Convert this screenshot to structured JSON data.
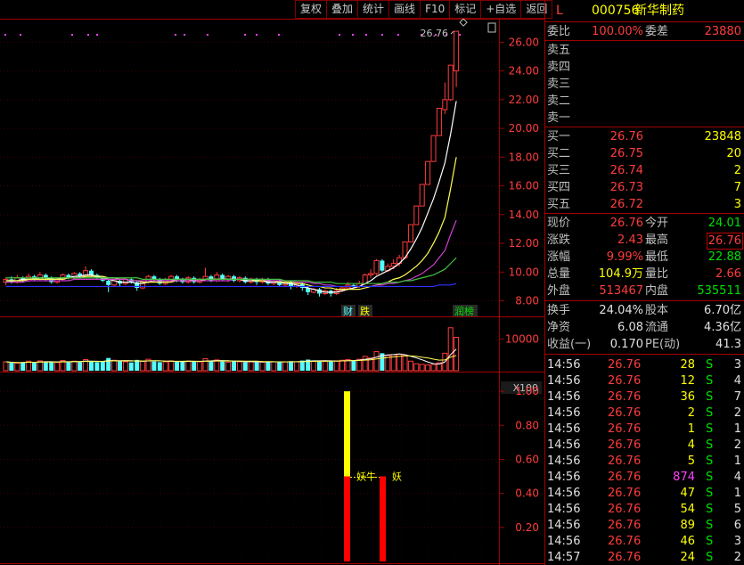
{
  "toolbar": [
    "复权",
    "叠加",
    "统计",
    "画线",
    "F10",
    "标记",
    "+自选",
    "返回"
  ],
  "stock": {
    "flag": "L",
    "code": "000756",
    "name": "新华制药"
  },
  "weibi": {
    "label1": "委比",
    "value1": "100.00%",
    "label2": "委差",
    "value2": "23880"
  },
  "sells": [
    {
      "label": "卖五",
      "price": "",
      "vol": ""
    },
    {
      "label": "卖四",
      "price": "",
      "vol": ""
    },
    {
      "label": "卖三",
      "price": "",
      "vol": ""
    },
    {
      "label": "卖二",
      "price": "",
      "vol": ""
    },
    {
      "label": "卖一",
      "price": "",
      "vol": ""
    }
  ],
  "buys": [
    {
      "label": "买一",
      "price": "26.76",
      "vol": "23848"
    },
    {
      "label": "买二",
      "price": "26.75",
      "vol": "20"
    },
    {
      "label": "买三",
      "price": "26.74",
      "vol": "2"
    },
    {
      "label": "买四",
      "price": "26.73",
      "vol": "7"
    },
    {
      "label": "买五",
      "price": "26.72",
      "vol": "3"
    }
  ],
  "quote": [
    {
      "l1": "现价",
      "v1": "26.76",
      "l2": "今开",
      "v2": "24.01"
    },
    {
      "l1": "涨跌",
      "v1": "2.43",
      "l2": "最高",
      "v2": "26.76"
    },
    {
      "l1": "涨幅",
      "v1": "9.99%",
      "l2": "最低",
      "v2": "22.88"
    },
    {
      "l1": "总量",
      "v1": "104.9万",
      "l2": "量比",
      "v2": "2.66"
    },
    {
      "l1": "外盘",
      "v1": "513467",
      "l2": "内盘",
      "v2": "535511"
    }
  ],
  "fund": [
    {
      "l1": "换手",
      "v1": "24.04%",
      "l2": "股本",
      "v2": "6.70亿"
    },
    {
      "l1": "净资",
      "v1": "6.08",
      "l2": "流通",
      "v2": "4.36亿"
    },
    {
      "l1": "收益(一)",
      "v1": "0.170",
      "l2": "PE(动)",
      "v2": "41.3"
    }
  ],
  "ticks": [
    {
      "time": "14:56",
      "price": "26.76",
      "vol": "28",
      "side": "S",
      "n": "3"
    },
    {
      "time": "14:56",
      "price": "26.76",
      "vol": "12",
      "side": "S",
      "n": "4"
    },
    {
      "time": "14:56",
      "price": "26.76",
      "vol": "36",
      "side": "S",
      "n": "7"
    },
    {
      "time": "14:56",
      "price": "26.76",
      "vol": "2",
      "side": "S",
      "n": "2"
    },
    {
      "time": "14:56",
      "price": "26.76",
      "vol": "1",
      "side": "S",
      "n": "1"
    },
    {
      "time": "14:56",
      "price": "26.76",
      "vol": "4",
      "side": "S",
      "n": "2"
    },
    {
      "time": "14:56",
      "price": "26.76",
      "vol": "5",
      "side": "S",
      "n": "1"
    },
    {
      "time": "14:56",
      "price": "26.76",
      "vol": "874",
      "side": "S",
      "n": "4"
    },
    {
      "time": "14:56",
      "price": "26.76",
      "vol": "47",
      "side": "S",
      "n": "1"
    },
    {
      "time": "14:56",
      "price": "26.76",
      "vol": "54",
      "side": "S",
      "n": "5"
    },
    {
      "time": "14:56",
      "price": "26.76",
      "vol": "89",
      "side": "S",
      "n": "6"
    },
    {
      "time": "14:56",
      "price": "26.76",
      "vol": "46",
      "side": "S",
      "n": "3"
    },
    {
      "time": "14:57",
      "price": "26.76",
      "vol": "24",
      "side": "S",
      "n": "2"
    }
  ],
  "chart_data": {
    "type": "candlestick",
    "price_ticks": [
      "26.00",
      "24.00",
      "22.00",
      "20.00",
      "18.00",
      "16.00",
      "14.00",
      "12.00",
      "10.00",
      "8.00"
    ],
    "price_ylim": [
      7.6,
      27.2
    ],
    "high_annotation": "26.76",
    "volume_tick": "10000",
    "volume_unit": "X100",
    "indicator_ticks": [
      "1.00",
      "0.80",
      "0.60",
      "0.40",
      "0.20"
    ],
    "indicator_ylim": [
      0,
      1.1
    ],
    "event_labels": [
      "财",
      "跌",
      "润榜"
    ],
    "indicator_labels": [
      "妖牛",
      "妖"
    ],
    "candles": [
      [
        9.3,
        9.5,
        9.1,
        9.6
      ],
      [
        9.5,
        9.3,
        9.2,
        9.7
      ],
      [
        9.3,
        9.6,
        9.2,
        9.8
      ],
      [
        9.6,
        9.4,
        9.3,
        9.7
      ],
      [
        9.4,
        9.7,
        9.3,
        9.9
      ],
      [
        9.7,
        9.5,
        9.4,
        9.8
      ],
      [
        9.5,
        9.8,
        9.4,
        10.0
      ],
      [
        9.8,
        9.6,
        9.4,
        9.9
      ],
      [
        9.6,
        9.3,
        9.2,
        9.7
      ],
      [
        9.3,
        9.5,
        9.2,
        9.6
      ],
      [
        9.5,
        9.8,
        9.4,
        9.9
      ],
      [
        9.8,
        9.6,
        9.5,
        9.9
      ],
      [
        9.6,
        9.9,
        9.5,
        10.0
      ],
      [
        9.9,
        9.7,
        9.6,
        10.0
      ],
      [
        9.7,
        10.1,
        9.6,
        10.4
      ],
      [
        10.1,
        9.8,
        9.7,
        10.2
      ],
      [
        9.8,
        9.6,
        9.5,
        9.9
      ],
      [
        9.6,
        9.4,
        9.3,
        9.7
      ],
      [
        9.4,
        9.1,
        8.6,
        9.5
      ],
      [
        9.1,
        9.4,
        9.0,
        9.5
      ],
      [
        9.4,
        9.2,
        9.0,
        9.5
      ],
      [
        9.2,
        9.5,
        9.1,
        9.6
      ],
      [
        9.5,
        9.3,
        9.2,
        9.6
      ],
      [
        9.3,
        8.9,
        8.7,
        9.4
      ],
      [
        8.9,
        9.3,
        8.8,
        9.4
      ],
      [
        9.3,
        9.7,
        9.2,
        9.8
      ],
      [
        9.7,
        9.5,
        9.3,
        9.8
      ],
      [
        9.5,
        9.2,
        9.1,
        9.6
      ],
      [
        9.2,
        9.5,
        9.1,
        9.6
      ],
      [
        9.5,
        9.7,
        9.3,
        9.8
      ],
      [
        9.7,
        9.5,
        9.3,
        9.8
      ],
      [
        9.5,
        9.3,
        9.2,
        9.6
      ],
      [
        9.3,
        9.6,
        9.2,
        9.7
      ],
      [
        9.6,
        9.3,
        9.2,
        9.7
      ],
      [
        9.3,
        9.5,
        9.2,
        9.6
      ],
      [
        9.5,
        9.7,
        9.4,
        10.3
      ],
      [
        9.7,
        9.4,
        9.3,
        9.8
      ],
      [
        9.4,
        9.8,
        9.3,
        10.0
      ],
      [
        9.8,
        9.5,
        9.4,
        9.9
      ],
      [
        9.5,
        9.7,
        9.3,
        9.8
      ],
      [
        9.7,
        9.4,
        9.3,
        9.8
      ],
      [
        9.4,
        9.6,
        9.3,
        9.7
      ],
      [
        9.6,
        9.3,
        9.2,
        9.7
      ],
      [
        9.3,
        9.5,
        9.2,
        9.6
      ],
      [
        9.5,
        9.3,
        9.1,
        9.6
      ],
      [
        9.3,
        9.5,
        9.2,
        9.6
      ],
      [
        9.5,
        9.2,
        9.1,
        9.6
      ],
      [
        9.2,
        9.4,
        9.1,
        9.5
      ],
      [
        9.4,
        9.1,
        9.0,
        9.5
      ],
      [
        9.1,
        9.3,
        9.0,
        9.4
      ],
      [
        9.3,
        9.0,
        8.8,
        9.4
      ],
      [
        9.0,
        9.2,
        8.9,
        9.3
      ],
      [
        9.2,
        8.9,
        8.7,
        9.3
      ],
      [
        8.9,
        8.6,
        8.4,
        9.0
      ],
      [
        8.6,
        8.8,
        8.5,
        8.9
      ],
      [
        8.8,
        8.5,
        8.3,
        8.9
      ],
      [
        8.5,
        8.7,
        8.4,
        8.8
      ],
      [
        8.7,
        8.5,
        8.3,
        8.8
      ],
      [
        8.5,
        8.7,
        8.4,
        8.9
      ],
      [
        8.7,
        8.9,
        8.6,
        9.0
      ],
      [
        8.9,
        9.1,
        8.8,
        9.3
      ],
      [
        9.1,
        9.0,
        8.9,
        9.2
      ],
      [
        9.0,
        9.2,
        8.9,
        9.4
      ],
      [
        9.2,
        9.8,
        9.1,
        9.9
      ],
      [
        9.8,
        9.9,
        9.6,
        10.2
      ],
      [
        9.9,
        10.8,
        9.8,
        10.9
      ],
      [
        10.8,
        10.1,
        10.0,
        10.9
      ],
      [
        10.1,
        10.4,
        10.0,
        10.6
      ],
      [
        10.4,
        10.6,
        10.2,
        10.9
      ],
      [
        10.6,
        11.0,
        10.4,
        11.2
      ],
      [
        11.0,
        12.1,
        10.9,
        12.1
      ],
      [
        12.1,
        13.3,
        12.1,
        13.3
      ],
      [
        13.3,
        14.6,
        13.3,
        14.6
      ],
      [
        14.6,
        16.1,
        14.6,
        16.1
      ],
      [
        16.1,
        17.7,
        16.1,
        17.7
      ],
      [
        17.7,
        19.5,
        17.7,
        19.5
      ],
      [
        19.5,
        21.4,
        19.5,
        21.4
      ],
      [
        21.3,
        22.0,
        21.0,
        23.2
      ],
      [
        22.0,
        24.4,
        21.9,
        24.4
      ],
      [
        24.0,
        26.76,
        22.88,
        26.76
      ]
    ],
    "volumes": [
      28,
      25,
      24,
      27,
      30,
      26,
      31,
      28,
      27,
      26,
      32,
      29,
      30,
      27,
      35,
      30,
      27,
      28,
      40,
      33,
      30,
      28,
      26,
      34,
      30,
      36,
      29,
      27,
      28,
      31,
      30,
      28,
      30,
      29,
      28,
      38,
      30,
      34,
      29,
      27,
      30,
      28,
      27,
      29,
      28,
      27,
      29,
      28,
      27,
      28,
      30,
      28,
      32,
      35,
      30,
      31,
      29,
      30,
      31,
      33,
      35,
      32,
      36,
      45,
      40,
      60,
      55,
      48,
      50,
      52,
      48,
      30,
      22,
      20,
      18,
      20,
      25,
      55,
      135,
      105
    ],
    "ma_series": [
      {
        "color": "#ffffff",
        "values": [
          9.4,
          9.4,
          9.4,
          9.5,
          9.5,
          9.5,
          9.6,
          9.6,
          9.5,
          9.5,
          9.6,
          9.6,
          9.7,
          9.7,
          9.8,
          9.8,
          9.7,
          9.6,
          9.5,
          9.4,
          9.3,
          9.3,
          9.3,
          9.2,
          9.2,
          9.3,
          9.4,
          9.4,
          9.4,
          9.4,
          9.5,
          9.5,
          9.5,
          9.4,
          9.4,
          9.5,
          9.5,
          9.5,
          9.5,
          9.5,
          9.5,
          9.5,
          9.4,
          9.4,
          9.4,
          9.4,
          9.3,
          9.3,
          9.3,
          9.2,
          9.2,
          9.1,
          9.0,
          8.9,
          8.8,
          8.7,
          8.6,
          8.6,
          8.6,
          8.7,
          8.8,
          8.9,
          9.0,
          9.2,
          9.4,
          9.7,
          9.9,
          10.1,
          10.3,
          10.6,
          11.0,
          11.6,
          12.3,
          13.1,
          14.1,
          15.1,
          16.3,
          17.6,
          19.6,
          21.9
        ]
      },
      {
        "color": "#ffff50",
        "values": [
          9.4,
          9.4,
          9.4,
          9.4,
          9.5,
          9.5,
          9.5,
          9.5,
          9.5,
          9.5,
          9.5,
          9.6,
          9.6,
          9.6,
          9.7,
          9.7,
          9.7,
          9.7,
          9.6,
          9.6,
          9.5,
          9.5,
          9.4,
          9.4,
          9.3,
          9.3,
          9.3,
          9.3,
          9.3,
          9.3,
          9.4,
          9.4,
          9.4,
          9.4,
          9.4,
          9.5,
          9.5,
          9.5,
          9.5,
          9.5,
          9.5,
          9.5,
          9.5,
          9.5,
          9.4,
          9.4,
          9.4,
          9.4,
          9.3,
          9.3,
          9.3,
          9.2,
          9.2,
          9.1,
          9.0,
          9.0,
          8.9,
          8.9,
          8.8,
          8.8,
          8.8,
          8.8,
          8.8,
          8.9,
          9.0,
          9.1,
          9.2,
          9.3,
          9.5,
          9.6,
          9.8,
          10.1,
          10.4,
          10.8,
          11.3,
          12.0,
          12.8,
          13.8,
          15.8,
          18.0
        ]
      },
      {
        "color": "#d040d0",
        "values": [
          9.3,
          9.3,
          9.3,
          9.3,
          9.4,
          9.4,
          9.4,
          9.4,
          9.4,
          9.4,
          9.4,
          9.4,
          9.5,
          9.5,
          9.5,
          9.5,
          9.5,
          9.5,
          9.5,
          9.5,
          9.5,
          9.5,
          9.4,
          9.4,
          9.4,
          9.4,
          9.4,
          9.4,
          9.4,
          9.4,
          9.4,
          9.4,
          9.4,
          9.4,
          9.4,
          9.4,
          9.4,
          9.4,
          9.4,
          9.4,
          9.5,
          9.5,
          9.5,
          9.5,
          9.5,
          9.5,
          9.4,
          9.4,
          9.4,
          9.4,
          9.4,
          9.3,
          9.3,
          9.3,
          9.2,
          9.2,
          9.1,
          9.1,
          9.0,
          9.0,
          9.0,
          9.0,
          9.0,
          9.0,
          9.0,
          9.1,
          9.1,
          9.2,
          9.2,
          9.3,
          9.4,
          9.5,
          9.7,
          9.9,
          10.2,
          10.5,
          11.0,
          11.5,
          12.6,
          13.6
        ]
      },
      {
        "color": "#40c040",
        "values": [
          9.6,
          9.6,
          9.6,
          9.6,
          9.6,
          9.6,
          9.6,
          9.6,
          9.6,
          9.6,
          9.6,
          9.6,
          9.6,
          9.6,
          9.6,
          9.6,
          9.6,
          9.6,
          9.6,
          9.6,
          9.6,
          9.6,
          9.6,
          9.6,
          9.5,
          9.5,
          9.5,
          9.5,
          9.5,
          9.5,
          9.5,
          9.5,
          9.5,
          9.5,
          9.5,
          9.5,
          9.5,
          9.5,
          9.5,
          9.5,
          9.5,
          9.5,
          9.5,
          9.5,
          9.5,
          9.5,
          9.5,
          9.5,
          9.5,
          9.4,
          9.4,
          9.4,
          9.4,
          9.4,
          9.3,
          9.3,
          9.3,
          9.3,
          9.2,
          9.2,
          9.2,
          9.2,
          9.2,
          9.2,
          9.2,
          9.2,
          9.2,
          9.3,
          9.3,
          9.3,
          9.4,
          9.4,
          9.5,
          9.6,
          9.7,
          9.8,
          10.0,
          10.2,
          10.6,
          11.0
        ]
      },
      {
        "color": "#3030ff",
        "values": [
          9.0,
          9.0,
          9.0,
          9.0,
          9.0,
          9.0,
          9.0,
          9.0,
          9.0,
          9.0,
          9.0,
          9.0,
          9.0,
          9.0,
          9.0,
          9.0,
          9.0,
          9.0,
          9.0,
          9.0,
          9.0,
          9.0,
          9.0,
          9.0,
          9.0,
          9.0,
          9.0,
          9.0,
          9.0,
          9.0,
          9.0,
          9.0,
          9.0,
          9.0,
          9.0,
          9.0,
          9.0,
          9.0,
          9.0,
          9.0,
          9.0,
          9.0,
          9.0,
          9.0,
          9.0,
          9.0,
          9.0,
          9.0,
          9.0,
          9.0,
          9.0,
          9.0,
          9.0,
          9.0,
          9.0,
          9.0,
          9.0,
          9.0,
          9.0,
          9.0,
          9.0,
          9.0,
          9.0,
          9.0,
          9.0,
          9.0,
          9.0,
          9.0,
          9.0,
          9.0,
          9.0,
          9.0,
          9.0,
          9.0,
          9.0,
          9.0,
          9.1,
          9.1,
          9.1,
          9.2
        ]
      }
    ],
    "indicator_bars": [
      {
        "index": 72,
        "red_top": 0.5,
        "yellow_top": 1.0
      },
      {
        "index": 76,
        "red_top": 0.5,
        "yellow_top": 0
      }
    ]
  }
}
